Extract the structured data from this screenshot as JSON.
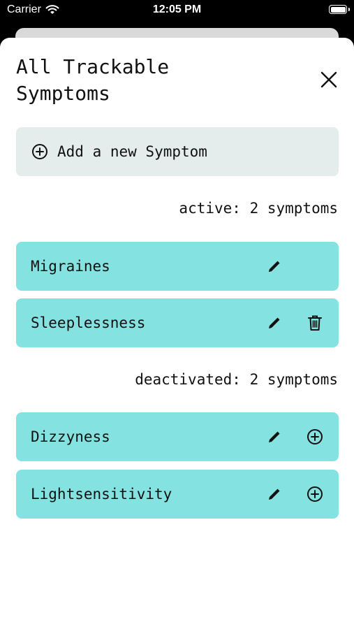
{
  "status_bar": {
    "carrier": "Carrier",
    "time": "12:05 PM"
  },
  "sheet": {
    "title": "All Trackable Symptoms",
    "close_icon": "close-icon",
    "add_button": {
      "label": "Add a new Symptom",
      "icon": "plus-circle-icon"
    },
    "active_section": {
      "label": "active: 2 symptoms",
      "items": [
        {
          "name": "Migraines",
          "actions": [
            "edit"
          ]
        },
        {
          "name": "Sleeplessness",
          "actions": [
            "edit",
            "delete"
          ]
        }
      ]
    },
    "deactivated_section": {
      "label": "deactivated: 2 symptoms",
      "items": [
        {
          "name": "Dizzyness",
          "actions": [
            "edit",
            "activate"
          ]
        },
        {
          "name": "Lightsensitivity",
          "actions": [
            "edit",
            "activate"
          ]
        }
      ]
    }
  },
  "colors": {
    "row_background": "#84e2e0",
    "add_button_background": "#e4ecec",
    "text": "#111111"
  }
}
